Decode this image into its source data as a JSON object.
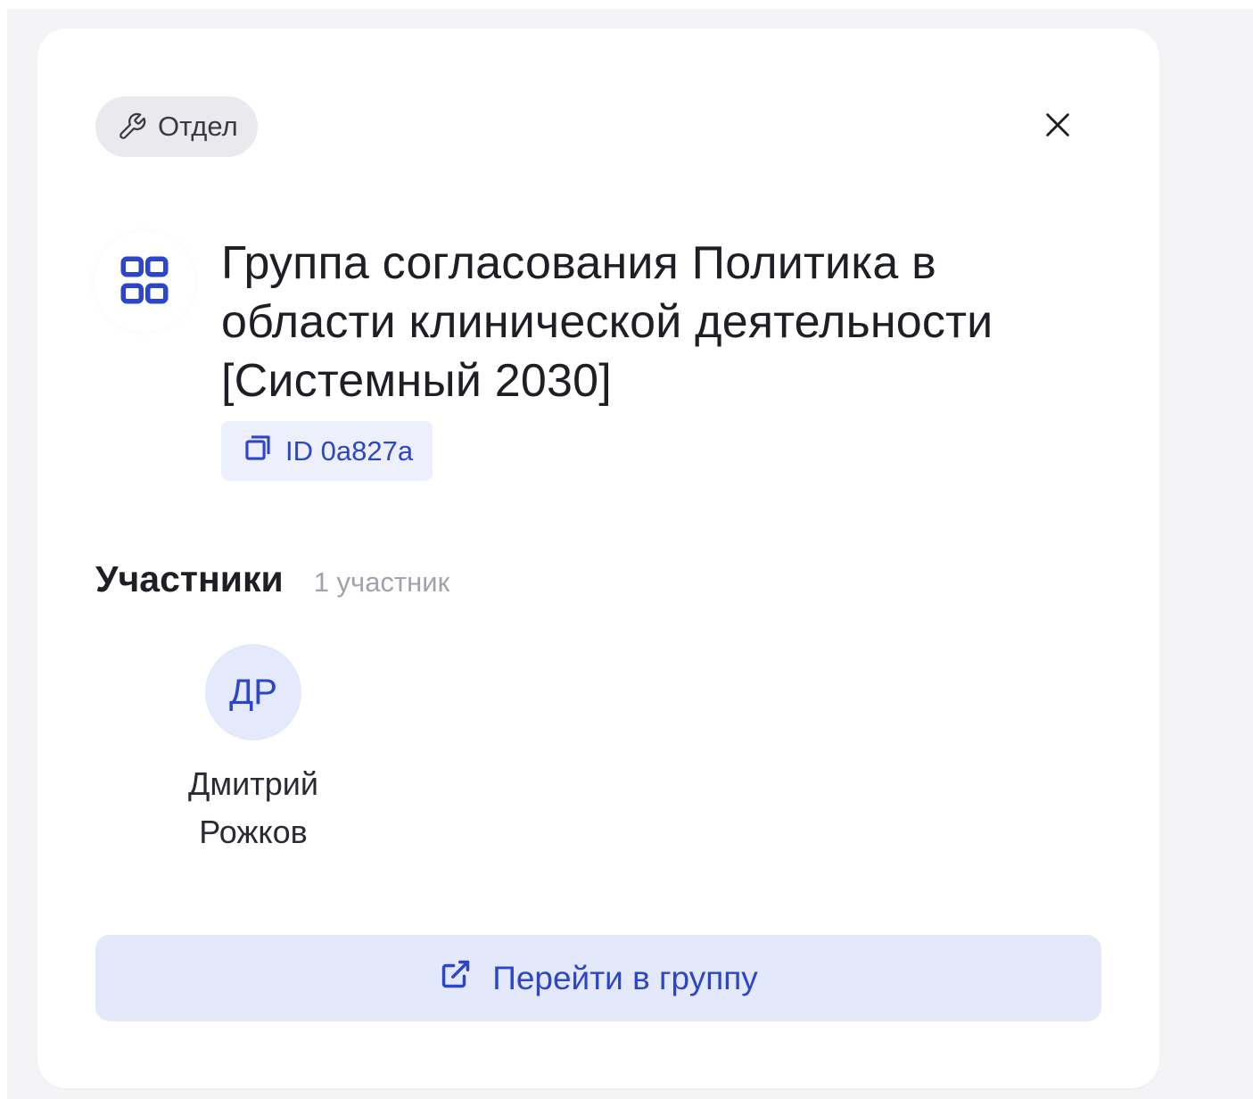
{
  "panel": {
    "type_chip": {
      "icon": "wrench-icon",
      "label": "Отдел"
    },
    "close": {
      "icon": "close-icon"
    },
    "group": {
      "icon": "grid-icon",
      "title": "Группа согласования Политика в области клинической деятельности [Системный 2030]",
      "id_chip": {
        "icon": "copy-icon",
        "label": "ID 0a827a"
      }
    },
    "members": {
      "title": "Участники",
      "count": "1 участник",
      "items": [
        {
          "initials": "ДР",
          "first_name": "Дмитрий",
          "last_name": "Рожков"
        }
      ]
    },
    "goto_button": {
      "icon": "external-link-icon",
      "label": "Перейти в группу"
    }
  },
  "colors": {
    "accent": "#2d45c8",
    "accent_bg": "#e4e8fb",
    "chip_bg": "#e9e9ee",
    "page_bg": "#f4f4f6"
  }
}
